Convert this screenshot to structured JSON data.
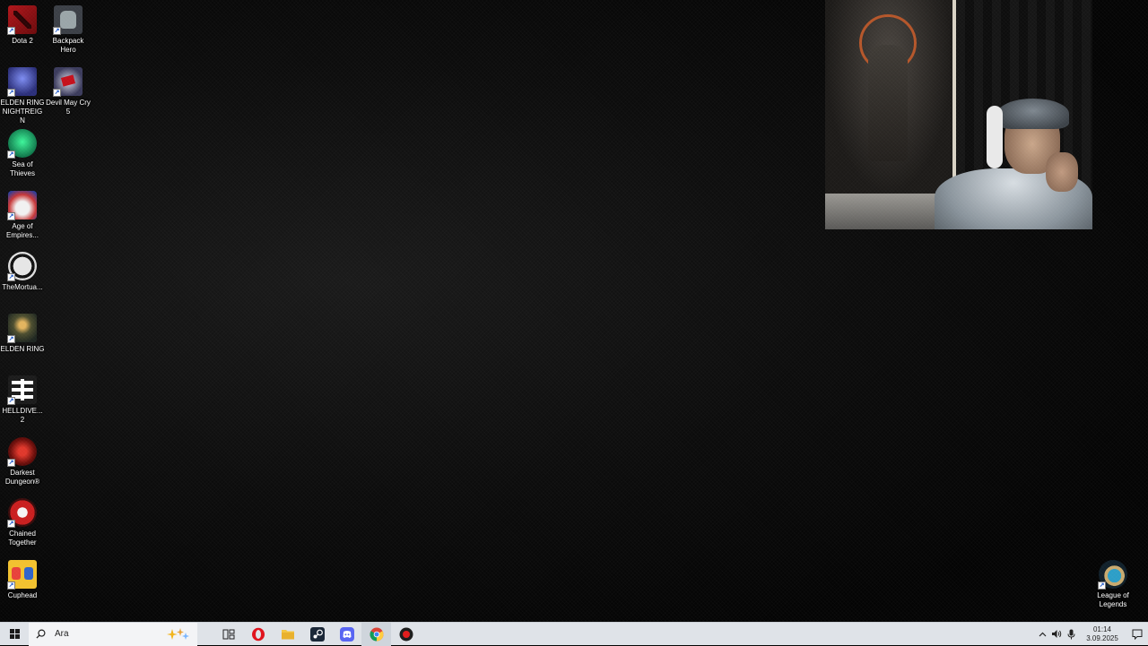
{
  "desktop_icons": [
    {
      "label": "Dota 2",
      "icon": "dota2-icon"
    },
    {
      "label": "Backpack Hero",
      "icon": "backpack-hero-icon"
    },
    {
      "label": "ELDEN RING NIGHTREIGN",
      "icon": "elden-ring-nightreign-icon"
    },
    {
      "label": "Devil May Cry 5",
      "icon": "devil-may-cry-5-icon"
    },
    {
      "label": "Sea of Thieves",
      "icon": "sea-of-thieves-icon"
    },
    {
      "label": "Age of Empires...",
      "icon": "age-of-empires-icon"
    },
    {
      "label": "TheMortua...",
      "icon": "the-mortuary-icon"
    },
    {
      "label": "ELDEN RING",
      "icon": "elden-ring-icon"
    },
    {
      "label": "HELLDIVE... 2",
      "icon": "helldivers-2-icon"
    },
    {
      "label": "Darkest Dungeon®",
      "icon": "darkest-dungeon-icon"
    },
    {
      "label": "Chained Together",
      "icon": "chained-together-icon"
    },
    {
      "label": "Cuphead",
      "icon": "cuphead-icon"
    },
    {
      "label": "League of Legends",
      "icon": "league-of-legends-icon"
    }
  ],
  "taskbar": {
    "search_placeholder": "Ara",
    "apps": [
      {
        "name": "task-view",
        "icon": "task-view-icon"
      },
      {
        "name": "opera",
        "icon": "opera-icon"
      },
      {
        "name": "file-explorer",
        "icon": "folder-icon"
      },
      {
        "name": "steam",
        "icon": "steam-icon"
      },
      {
        "name": "discord",
        "icon": "discord-icon"
      },
      {
        "name": "chrome",
        "icon": "chrome-icon"
      },
      {
        "name": "recorder",
        "icon": "record-app-icon"
      }
    ],
    "time": "01:14",
    "date": "3.09.2025"
  },
  "colors": {
    "taskbar_bg": "#dfe3e8",
    "desktop_bg": "#050505",
    "label_text": "#ffffff"
  }
}
